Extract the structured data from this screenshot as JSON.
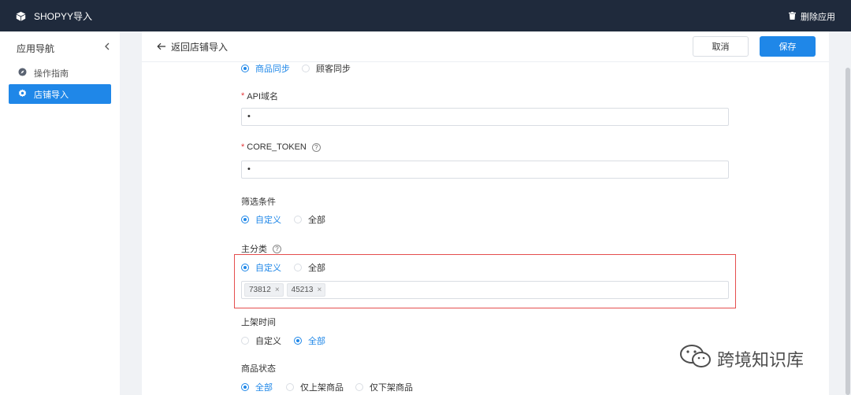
{
  "topbar": {
    "title": "SHOPYY导入",
    "delete_label": "删除应用"
  },
  "sidebar": {
    "header": "应用导航",
    "items": [
      {
        "label": "操作指南"
      },
      {
        "label": "店铺导入"
      }
    ]
  },
  "header": {
    "back_label": "返回店铺导入",
    "cancel_label": "取消",
    "save_label": "保存"
  },
  "form": {
    "sync_options": [
      "商品同步",
      "顾客同步"
    ],
    "api_domain": {
      "label": "API域名",
      "value": "•"
    },
    "core_token": {
      "label": "CORE_TOKEN",
      "value": "•",
      "help": "?"
    },
    "filter": {
      "label": "筛选条件",
      "options": [
        "自定义",
        "全部"
      ]
    },
    "main_category": {
      "label": "主分类",
      "help": "?",
      "options": [
        "自定义",
        "全部"
      ],
      "tags": [
        "73812",
        "45213"
      ],
      "tag_remove": "×"
    },
    "listing_time": {
      "label": "上架时间",
      "options": [
        "自定义",
        "全部"
      ]
    },
    "product_status": {
      "label": "商品状态",
      "options": [
        "全部",
        "仅上架商品",
        "仅下架商品"
      ]
    }
  },
  "watermark": "跨境知识库",
  "colors": {
    "accent": "#1f87e8",
    "topbar": "#1f2a3c",
    "highlight_border": "#e54e4e",
    "required": "#e4393c"
  }
}
